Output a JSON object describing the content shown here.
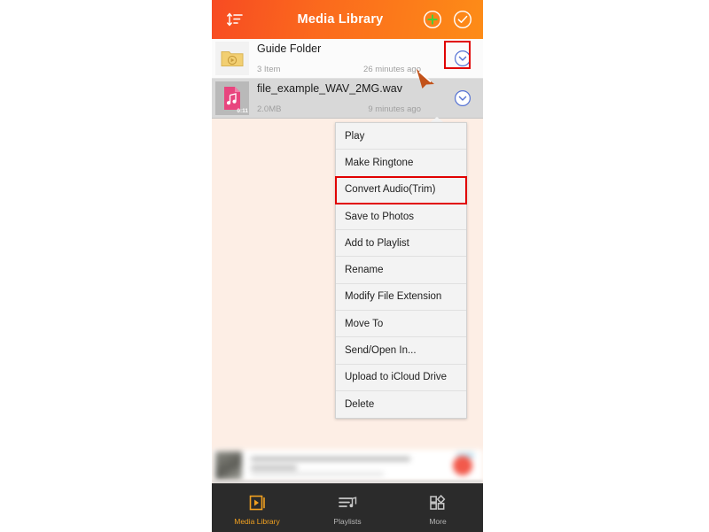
{
  "header": {
    "title": "Media Library",
    "sort_icon": "sort-icon",
    "add_icon": "plus-circle-icon",
    "select_icon": "check-circle-icon",
    "accent_start": "#f74b22",
    "accent_end": "#fd8c17"
  },
  "list": {
    "items": [
      {
        "name": "Guide Folder",
        "subtitle": "3 Item",
        "time": "26 minutes ago",
        "icon": "folder-play-icon",
        "duration": "",
        "selected": false
      },
      {
        "name": "file_example_WAV_2MG.wav",
        "subtitle": "2.0MB",
        "time": "9 minutes ago",
        "icon": "audio-file-icon",
        "duration": "0:11",
        "selected": true
      }
    ]
  },
  "menu": {
    "items": [
      {
        "label": "Play",
        "highlighted": false
      },
      {
        "label": "Make Ringtone",
        "highlighted": false
      },
      {
        "label": "Convert Audio(Trim)",
        "highlighted": true
      },
      {
        "label": "Save to Photos",
        "highlighted": false
      },
      {
        "label": "Add to Playlist",
        "highlighted": false
      },
      {
        "label": "Rename",
        "highlighted": false
      },
      {
        "label": "Modify File Extension",
        "highlighted": false
      },
      {
        "label": "Move To",
        "highlighted": false
      },
      {
        "label": "Send/Open In...",
        "highlighted": false
      },
      {
        "label": "Upload to iCloud Drive",
        "highlighted": false
      },
      {
        "label": "Delete",
        "highlighted": false
      }
    ]
  },
  "annotation": {
    "highlight_color": "#e10000",
    "target": "row-chevron-button",
    "cursor": "pointer-arrow"
  },
  "tabbar": {
    "items": [
      {
        "label": "Media Library",
        "icon": "media-library-icon",
        "active": true
      },
      {
        "label": "Playlists",
        "icon": "playlists-icon",
        "active": false
      },
      {
        "label": "More",
        "icon": "more-grid-icon",
        "active": false
      }
    ],
    "active_color": "#f0a020",
    "background": "#2b2b2b"
  }
}
